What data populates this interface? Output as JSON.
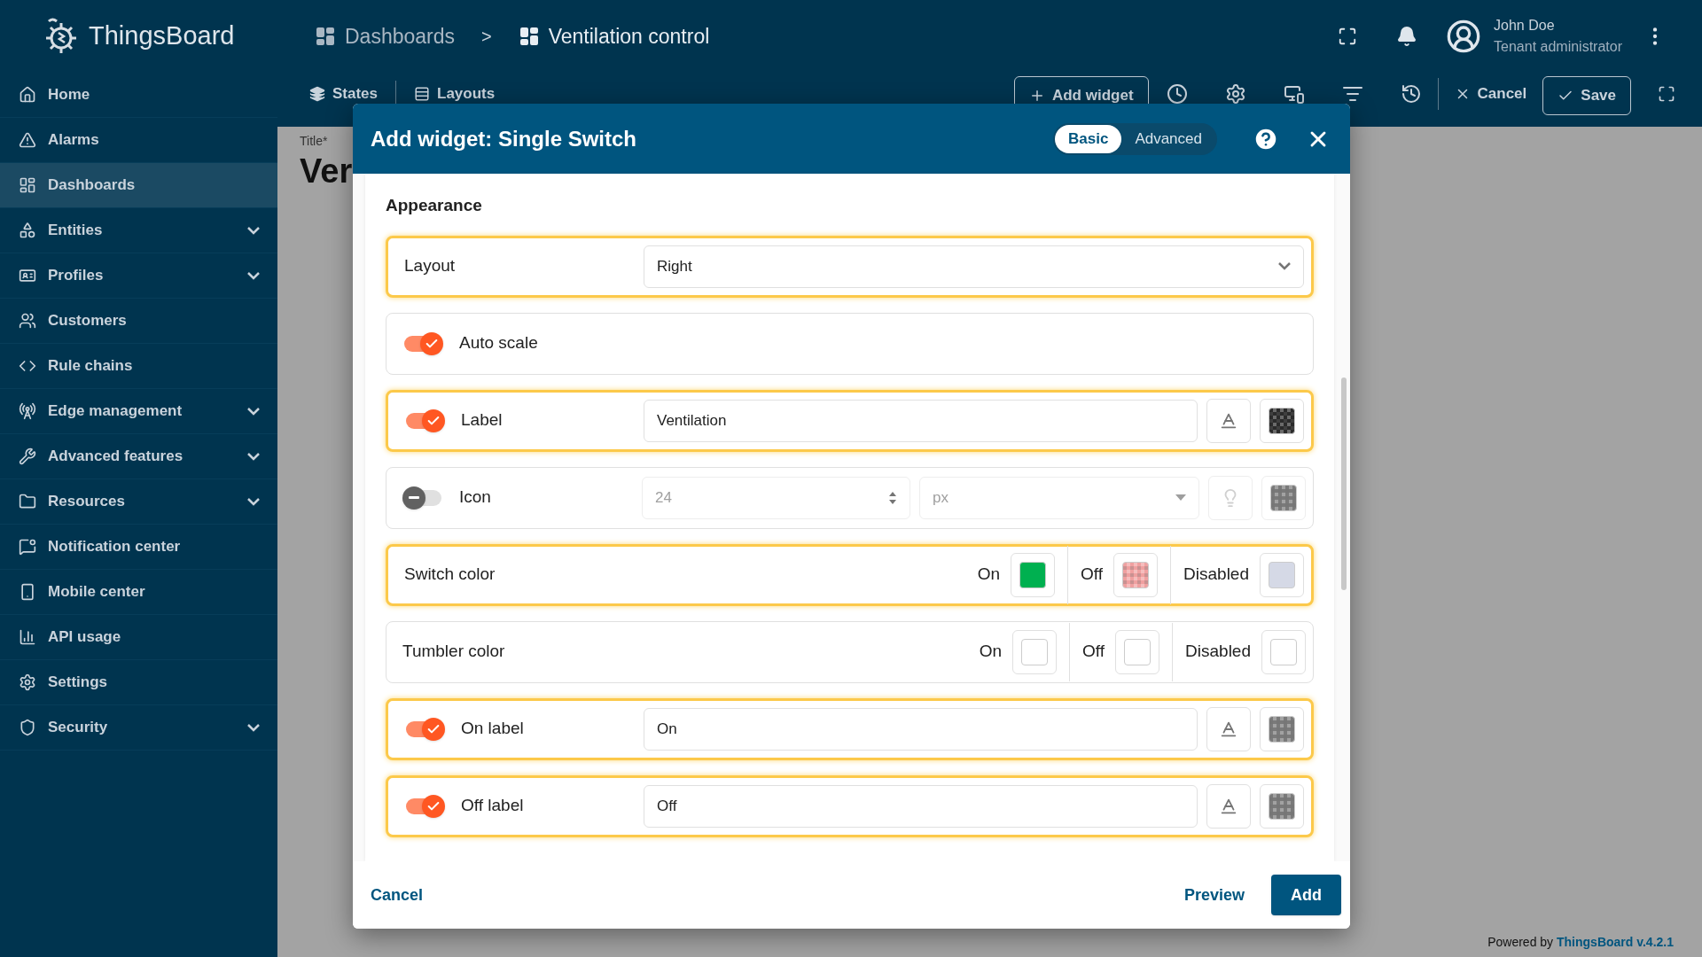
{
  "header": {
    "logo_text": "ThingsBoard",
    "breadcrumb": [
      {
        "label": "Dashboards"
      },
      {
        "label": "Ventilation control"
      }
    ],
    "breadcrumb_separator": ">",
    "user": {
      "name": "John Doe",
      "role": "Tenant administrator"
    }
  },
  "sidebar": {
    "items": [
      {
        "label": "Home",
        "selected": false,
        "expandable": false
      },
      {
        "label": "Alarms",
        "selected": false,
        "expandable": false
      },
      {
        "label": "Dashboards",
        "selected": true,
        "expandable": false
      },
      {
        "label": "Entities",
        "selected": false,
        "expandable": true
      },
      {
        "label": "Profiles",
        "selected": false,
        "expandable": true
      },
      {
        "label": "Customers",
        "selected": false,
        "expandable": false
      },
      {
        "label": "Rule chains",
        "selected": false,
        "expandable": false
      },
      {
        "label": "Edge management",
        "selected": false,
        "expandable": true
      },
      {
        "label": "Advanced features",
        "selected": false,
        "expandable": true
      },
      {
        "label": "Resources",
        "selected": false,
        "expandable": true
      },
      {
        "label": "Notification center",
        "selected": false,
        "expandable": false
      },
      {
        "label": "Mobile center",
        "selected": false,
        "expandable": false
      },
      {
        "label": "API usage",
        "selected": false,
        "expandable": false
      },
      {
        "label": "Settings",
        "selected": false,
        "expandable": false
      },
      {
        "label": "Security",
        "selected": false,
        "expandable": true
      }
    ]
  },
  "toolbar": {
    "states": "States",
    "layouts": "Layouts",
    "add_widget": "Add widget",
    "cancel": "Cancel",
    "save": "Save"
  },
  "dashboard": {
    "title_label": "Title*",
    "title_value": "Ver"
  },
  "dialog": {
    "title": "Add widget:",
    "widget_name": "Single Switch",
    "modes": [
      {
        "label": "Basic",
        "selected": true
      },
      {
        "label": "Advanced",
        "selected": false
      }
    ],
    "section": "Appearance",
    "rows": [
      {
        "kind": "select",
        "label": "Layout",
        "value": "Right",
        "highlighted": true
      },
      {
        "kind": "toggle",
        "label": "Auto scale",
        "on": true,
        "highlighted": false
      },
      {
        "kind": "text",
        "label": "Label",
        "on": true,
        "value": "Ventilation",
        "highlighted": true,
        "swatch": {
          "color": "#2b2b2b",
          "checkered": true
        }
      },
      {
        "kind": "icon",
        "label": "Icon",
        "on": false,
        "size": "24",
        "unit": "px",
        "highlighted": false,
        "swatch": {
          "color": "#7a7a7a",
          "checkered": true
        }
      },
      {
        "kind": "colors",
        "label": "Switch color",
        "highlighted": true,
        "colors": [
          {
            "label": "On",
            "color": "#00b050",
            "checkered": false
          },
          {
            "label": "Off",
            "color": "#f0a0a0",
            "checkered": true
          },
          {
            "label": "Disabled",
            "color": "#d5d9e6",
            "checkered": false
          }
        ]
      },
      {
        "kind": "colors",
        "label": "Tumbler color",
        "highlighted": false,
        "colors": [
          {
            "label": "On",
            "color": "#ffffff",
            "checkered": false
          },
          {
            "label": "Off",
            "color": "#ffffff",
            "checkered": false
          },
          {
            "label": "Disabled",
            "color": "#ffffff",
            "checkered": false
          }
        ]
      },
      {
        "kind": "text",
        "label": "On label",
        "on": true,
        "value": "On",
        "highlighted": true,
        "swatch": {
          "color": "#7a7a7a",
          "checkered": true
        }
      },
      {
        "kind": "text",
        "label": "Off label",
        "on": true,
        "value": "Off",
        "highlighted": true,
        "swatch": {
          "color": "#7a7a7a",
          "checkered": true
        }
      }
    ],
    "buttons": {
      "cancel": "Cancel",
      "preview": "Preview",
      "add": "Add"
    }
  },
  "footer": {
    "powered_by": "Powered by",
    "link": "ThingsBoard v.4.2.1"
  }
}
